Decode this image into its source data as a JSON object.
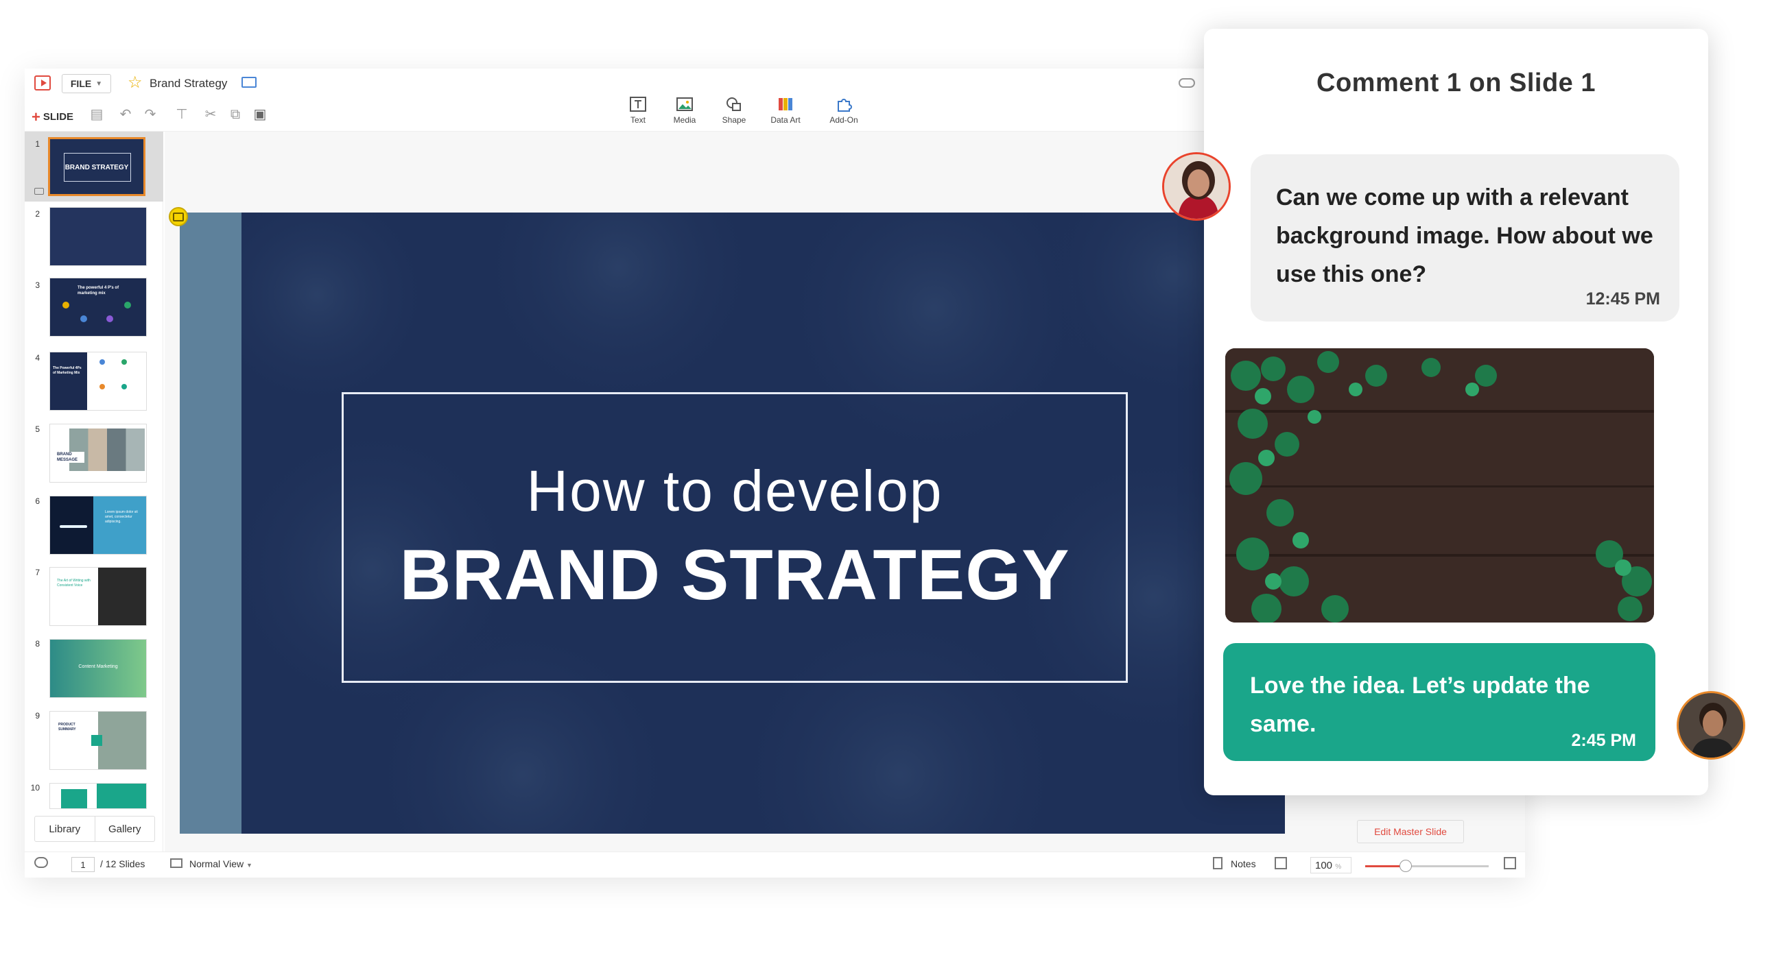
{
  "app": {
    "file_label": "FILE",
    "doc_title": "Brand Strategy",
    "add_slide_label": "SLIDE"
  },
  "toolbar": {
    "text_label": "Text",
    "media_label": "Media",
    "shape_label": "Shape",
    "dataart_label": "Data Art",
    "addon_label": "Add-On"
  },
  "slides": [
    {
      "number": "1",
      "title": "BRAND STRATEGY"
    },
    {
      "number": "2"
    },
    {
      "number": "3",
      "title": "The powerful 4 P's of marketing mix"
    },
    {
      "number": "4",
      "title": "The Powerful 4Ps of Marketing Mix"
    },
    {
      "number": "5",
      "title": "BRAND MESSAGE"
    },
    {
      "number": "6",
      "title": "Lorem ipsum dolor sit amet, consectetur adipiscing."
    },
    {
      "number": "7",
      "title": "The Art of Writing with Consistent Voice"
    },
    {
      "number": "8",
      "title": "Content Marketing"
    },
    {
      "number": "9",
      "title": "PRODUCT SUMMARY"
    },
    {
      "number": "10"
    }
  ],
  "sidebar_tabs": {
    "library": "Library",
    "gallery": "Gallery"
  },
  "slide_content": {
    "line1": "How to develop",
    "line2": "BRAND STRATEGY"
  },
  "status": {
    "current_page": "1",
    "total_slides": "/ 12 Slides",
    "view": "Normal View",
    "notes": "Notes",
    "zoom": "100",
    "zoom_unit": "%",
    "edit_master": "Edit Master Slide"
  },
  "comments": {
    "title": "Comment 1 on Slide 1",
    "first": {
      "text": "Can we come up with a relevant background image. How about we use this one?",
      "time": "12:45 PM"
    },
    "reply": {
      "text": "Love the idea. Let’s update the same.",
      "time": "2:45 PM"
    }
  },
  "colors": {
    "accent": "#e04a3f",
    "slide_bg": "#1e3058",
    "reply_bubble": "#1aa68a",
    "selection": "#e8892b"
  }
}
